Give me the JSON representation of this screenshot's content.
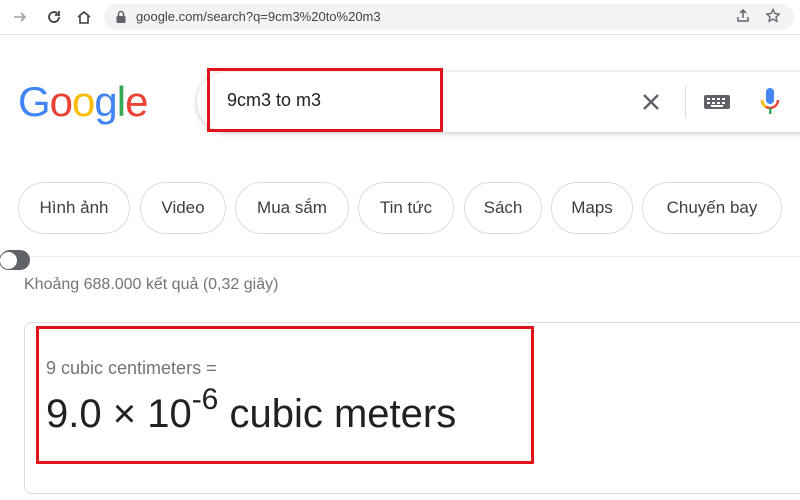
{
  "browser": {
    "url": "google.com/search?q=9cm3%20to%20m3"
  },
  "logo": {
    "letters": [
      "G",
      "o",
      "o",
      "g",
      "l",
      "e"
    ],
    "colors": [
      "#4285F4",
      "#EA4335",
      "#FBBC05",
      "#4285F4",
      "#34A853",
      "#EA4335"
    ]
  },
  "search": {
    "query": "9cm3 to m3"
  },
  "chips": [
    {
      "label": "Hình ảnh"
    },
    {
      "label": "Video"
    },
    {
      "label": "Mua sắm"
    },
    {
      "label": "Tin tức"
    },
    {
      "label": "Sách"
    },
    {
      "label": "Maps"
    },
    {
      "label": "Chuyến bay"
    }
  ],
  "results": {
    "stats": "Khoảng 688.000 kết quả (0,32 giây)"
  },
  "converter": {
    "input_text": "9 cubic centimeters =",
    "result_mantissa": "9.0 × 10",
    "result_exponent": "-6",
    "result_unit": " cubic meters"
  },
  "colors": {
    "highlight": "#e0131b",
    "mic_blue": "#4285F4",
    "mic_red": "#EA4335",
    "mic_yellow": "#FBBC05",
    "mic_green": "#34A853"
  }
}
